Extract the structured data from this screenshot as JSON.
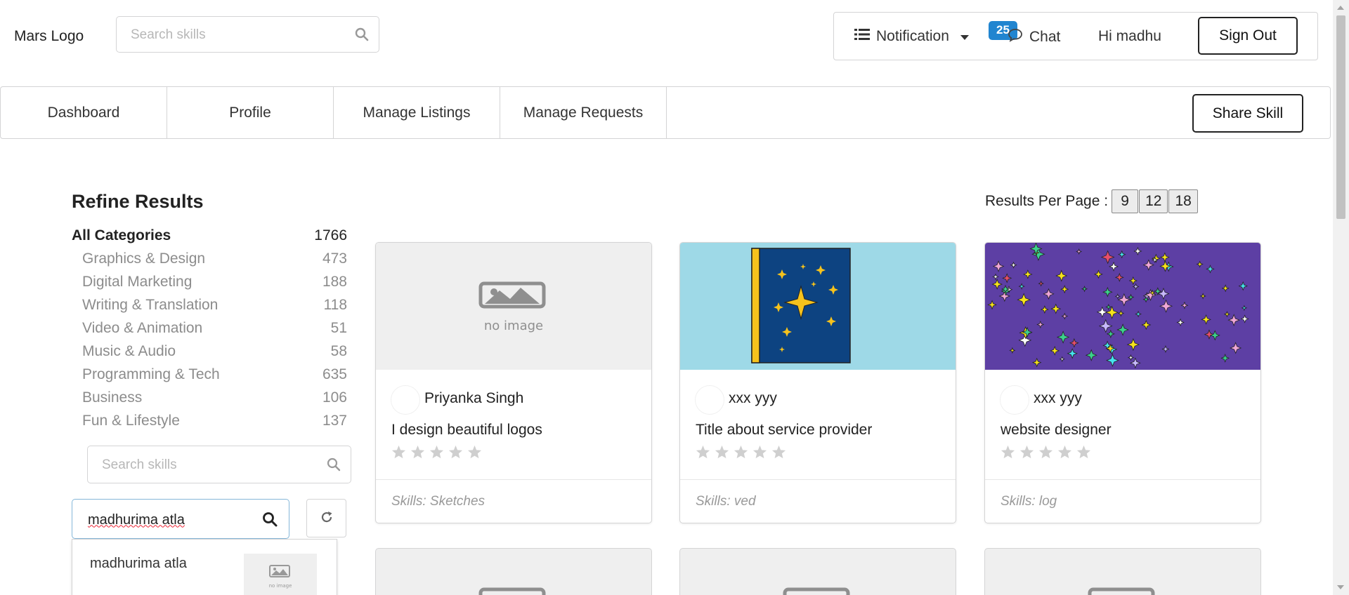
{
  "header": {
    "logo": "Mars Logo",
    "search_placeholder": "Search skills",
    "notification_label": "Notification",
    "notification_count": "25",
    "chat_label": "Chat",
    "greeting": "Hi madhu",
    "signout_label": "Sign Out"
  },
  "nav": {
    "tabs": [
      {
        "label": "Dashboard"
      },
      {
        "label": "Profile"
      },
      {
        "label": "Manage Listings"
      },
      {
        "label": "Manage Requests"
      }
    ],
    "share_label": "Share Skill"
  },
  "sidebar": {
    "title": "Refine Results",
    "categories": [
      {
        "name": "All Categories",
        "count": "1766"
      },
      {
        "name": "Graphics & Design",
        "count": "473"
      },
      {
        "name": "Digital Marketing",
        "count": "188"
      },
      {
        "name": "Writing & Translation",
        "count": "118"
      },
      {
        "name": "Video & Animation",
        "count": "51"
      },
      {
        "name": "Music & Audio",
        "count": "58"
      },
      {
        "name": "Programming & Tech",
        "count": "635"
      },
      {
        "name": "Business",
        "count": "106"
      },
      {
        "name": "Fun & Lifestyle",
        "count": "137"
      }
    ],
    "skill_search_placeholder": "Search skills",
    "user_search_value": "madhurima atla",
    "suggestion": {
      "name": "madhurima atla",
      "thumb_text": "no image"
    }
  },
  "results": {
    "per_page_label": "Results Per Page :",
    "per_page_options": [
      "9",
      "12",
      "18"
    ],
    "cards": [
      {
        "author": "Priyanka Singh",
        "title": "I design beautiful logos",
        "skills": "Skills: Sketches",
        "thumb_text": "no image",
        "rating": 0
      },
      {
        "author": "xxx yyy",
        "title": "Title about service provider",
        "skills": "Skills: ved",
        "rating": 0
      },
      {
        "author": "xxx yyy",
        "title": "website designer",
        "skills": "Skills: log",
        "rating": 0
      }
    ]
  },
  "colors": {
    "badge": "#2185d0",
    "star_empty": "#cfcfcf",
    "thumb_cyan": "#9ed9e7",
    "thumb_purple": "#5d3fa4",
    "book_blue": "#0d4381",
    "star_gold": "#f6c21c"
  },
  "icons": [
    "search-icon",
    "list-icon",
    "caret-down-icon",
    "chat-icon",
    "refresh-icon",
    "star-icon",
    "image-placeholder-icon"
  ]
}
